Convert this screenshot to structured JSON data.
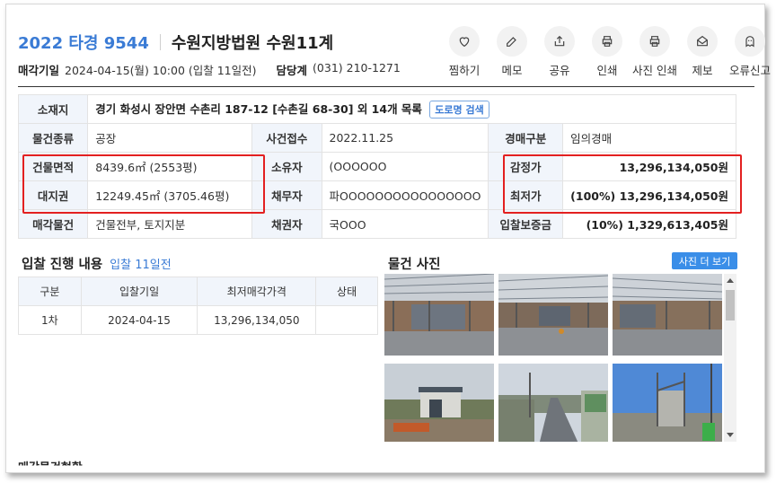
{
  "header": {
    "case_no": "2022 타경 9544",
    "court": "수원지방법원 수원11계",
    "sale_date_label": "매각기일",
    "sale_date": "2024-04-15(월) 10:00 (입찰 11일전)",
    "manager_label": "담당계",
    "manager_phone": "(031) 210-1271"
  },
  "actions": [
    {
      "label": "찜하기",
      "icon": "heart-icon"
    },
    {
      "label": "메모",
      "icon": "edit-icon"
    },
    {
      "label": "공유",
      "icon": "share-icon"
    },
    {
      "label": "인쇄",
      "icon": "printer-icon"
    },
    {
      "label": "사진 인쇄",
      "icon": "printer-icon"
    },
    {
      "label": "제보",
      "icon": "mail-icon"
    },
    {
      "label": "오류신고",
      "icon": "ghost-icon"
    }
  ],
  "info": {
    "address_label": "소재지",
    "address": "경기 화성시 장안면 수촌리 187-12 [수촌길 68-30] 외 14개 목록",
    "road_search": "도로명 검색",
    "type_label": "물건종류",
    "type": "공장",
    "filed_label": "사건접수",
    "filed": "2022.11.25",
    "auction_kind_label": "경매구분",
    "auction_kind": "임의경매",
    "building_area_label": "건물면적",
    "building_area": "8439.6㎡ (2553평)",
    "owner_label": "소유자",
    "owner": "(OOOOOO",
    "appraisal_label": "감정가",
    "appraisal": "13,296,134,050원",
    "land_label": "대지권",
    "land": "12249.45㎡ (3705.46평)",
    "debtor_label": "채무자",
    "debtor": "파OOOOOOOOOOOOOOOO",
    "min_price_label": "최저가",
    "min_price": "(100%) 13,296,134,050원",
    "sale_items_label": "매각물건",
    "sale_items": "건물전부, 토지지분",
    "creditor_label": "채권자",
    "creditor": "국OOO",
    "deposit_label": "입찰보증금",
    "deposit": "(10%) 1,329,613,405원"
  },
  "bidding": {
    "title": "입찰 진행 내용",
    "subtitle": "입찰 11일전",
    "columns": [
      "구분",
      "입찰기일",
      "최저매각가격",
      "상태"
    ],
    "rows": [
      [
        "1차",
        "2024-04-15",
        "13,296,134,050",
        ""
      ]
    ]
  },
  "photos": {
    "title": "물건 사진",
    "more_button": "사진 더 보기"
  },
  "next_section_partial": "매각물건현황"
}
